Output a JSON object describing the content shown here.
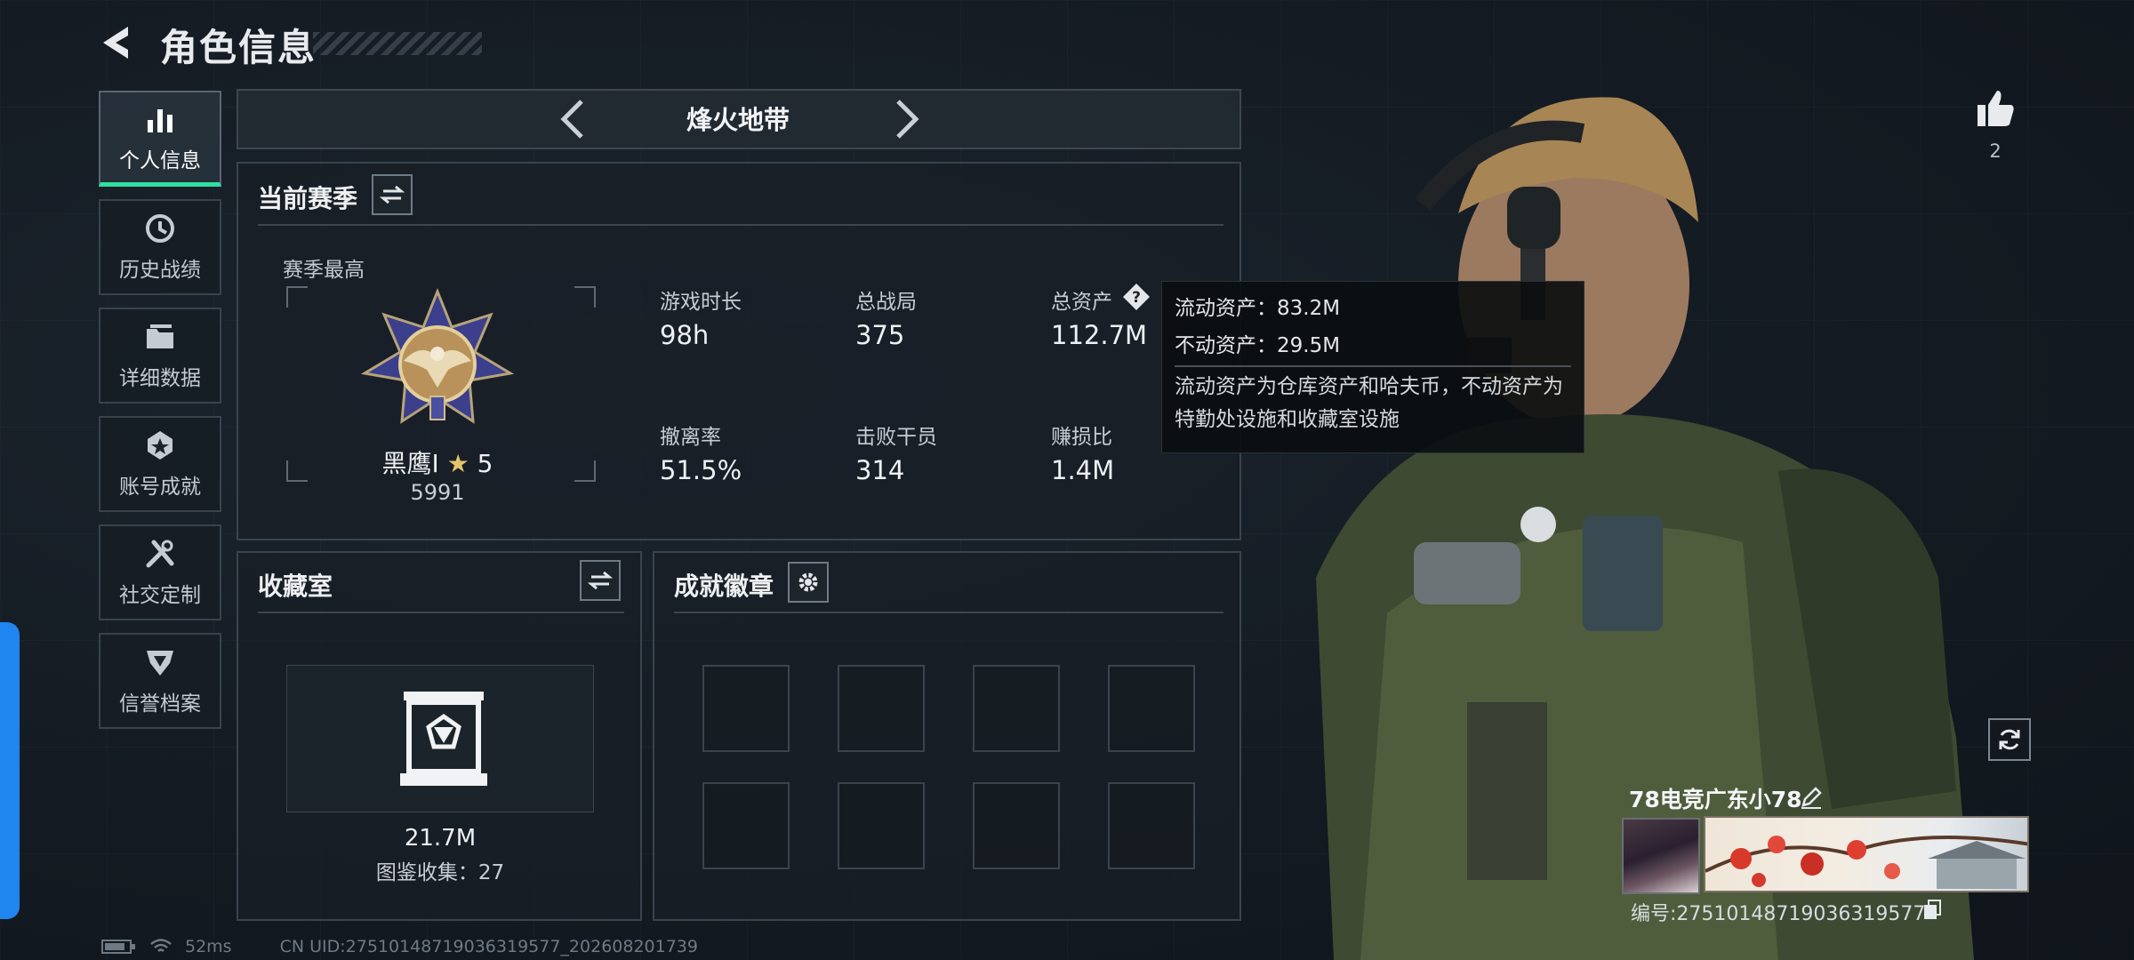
{
  "header": {
    "title": "角色信息"
  },
  "sidebar": {
    "items": [
      {
        "label": "个人信息",
        "icon": "bar-chart-icon",
        "active": true
      },
      {
        "label": "历史战绩",
        "icon": "history-clock-icon"
      },
      {
        "label": "详细数据",
        "icon": "folder-icon"
      },
      {
        "label": "账号成就",
        "icon": "achievement-icon"
      },
      {
        "label": "社交定制",
        "icon": "tools-icon"
      },
      {
        "label": "信誉档案",
        "icon": "credit-emblem-icon"
      }
    ]
  },
  "mode": {
    "title": "烽火地带"
  },
  "season": {
    "title": "当前赛季",
    "best_label": "赛季最高",
    "rank_name": "黑鹰I",
    "rank_stars": "5",
    "rank_score": "5991",
    "stats": [
      {
        "label": "游戏时长",
        "value": "98h"
      },
      {
        "label": "总战局",
        "value": "375"
      },
      {
        "label": "总资产",
        "value": "112.7M"
      },
      {
        "label": "撤离率",
        "value": "51.5%"
      },
      {
        "label": "击败干员",
        "value": "314"
      },
      {
        "label": "赚损比",
        "value": "1.4M"
      }
    ]
  },
  "tooltip": {
    "line1": "流动资产：83.2M",
    "line2": "不动资产：29.5M",
    "desc": "流动资产为仓库资产和哈夫币，不动资产为特勤处设施和收藏室设施"
  },
  "collection": {
    "title": "收藏室",
    "value": "21.7M",
    "count_text": "图鉴收集：27"
  },
  "badges": {
    "title": "成就徽章",
    "slots": 8
  },
  "player": {
    "likes": "2",
    "name": "78电竞广东小78",
    "id_text": "编号:2751014871903631957​7"
  },
  "status": {
    "ping": "52ms",
    "uid": "CN UID:2751014871903631957​7_202608201739"
  },
  "colors": {
    "accent": "#2fe0a3",
    "side_tab": "#1f86f0"
  }
}
